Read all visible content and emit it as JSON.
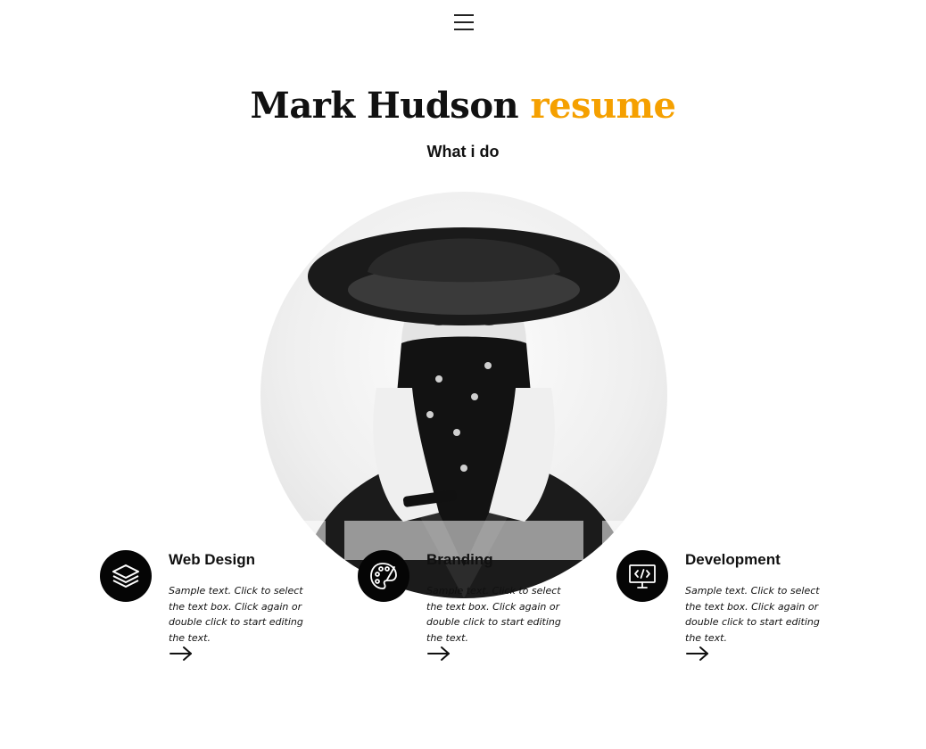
{
  "header": {
    "menu_icon": "hamburger-menu-icon"
  },
  "hero": {
    "title_name": "Mark Hudson",
    "title_accent": "resume",
    "subtitle": "What i do",
    "accent_color": "#f5a000"
  },
  "services": [
    {
      "icon": "layers-stack-icon",
      "title": "Web Design",
      "text": "Sample text. Click to select the text box. Click again or double click to start editing the text.",
      "arrow": "arrow-right-icon"
    },
    {
      "icon": "palette-brush-icon",
      "title": "Branding",
      "text": "Sample text. Click to select the text box. Click again or double click to start editing the text.",
      "arrow": "arrow-right-icon"
    },
    {
      "icon": "monitor-code-icon",
      "title": "Development",
      "text": "Sample text. Click to select the text box. Click again or double click to start editing the text.",
      "arrow": "arrow-right-icon"
    }
  ]
}
